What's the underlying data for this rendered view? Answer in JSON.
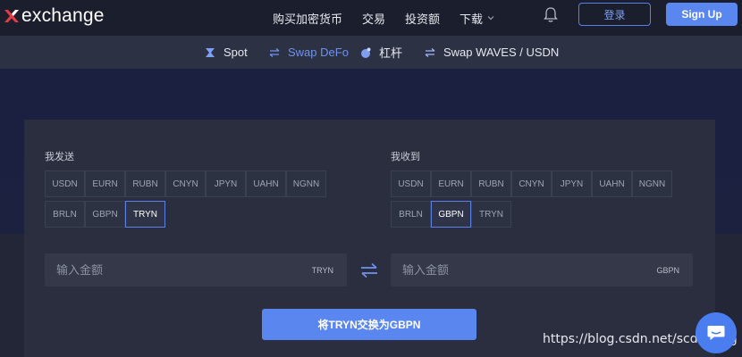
{
  "header": {
    "logo_text": "exchange",
    "nav": [
      {
        "label": "购买加密货币"
      },
      {
        "label": "交易"
      },
      {
        "label": "投资额"
      },
      {
        "label": "下载"
      }
    ],
    "login_label": "登录",
    "signup_label": "Sign Up"
  },
  "subnav": [
    {
      "label": "Spot",
      "icon": "spot-icon"
    },
    {
      "label": "Swap DeFo",
      "icon": "swap-icon",
      "active": true
    },
    {
      "label": "杠杆",
      "icon": "leverage-icon"
    },
    {
      "label": "Swap WAVES / USDN",
      "icon": "swap-icon"
    }
  ],
  "send": {
    "label": "我发送",
    "currencies": [
      "USDN",
      "EURN",
      "RUBN",
      "CNYN",
      "JPYN",
      "UAHN",
      "NGNN",
      "BRLN",
      "GBPN",
      "TRYN"
    ],
    "selected": "TRYN",
    "placeholder": "输入金额",
    "unit": "TRYN"
  },
  "receive": {
    "label": "我收到",
    "currencies": [
      "USDN",
      "EURN",
      "RUBN",
      "CNYN",
      "JPYN",
      "UAHN",
      "NGNN",
      "BRLN",
      "GBPN",
      "TRYN"
    ],
    "selected": "GBPN",
    "placeholder": "输入金额",
    "unit": "GBPN"
  },
  "exchange_button": "将TRYN交换为GBPN",
  "watermark": "https://blog.csdn.net/scdnbang",
  "colors": {
    "accent": "#5a86ef",
    "header_bg": "#1b1e2c",
    "card_bg": "#2a2e3f"
  }
}
